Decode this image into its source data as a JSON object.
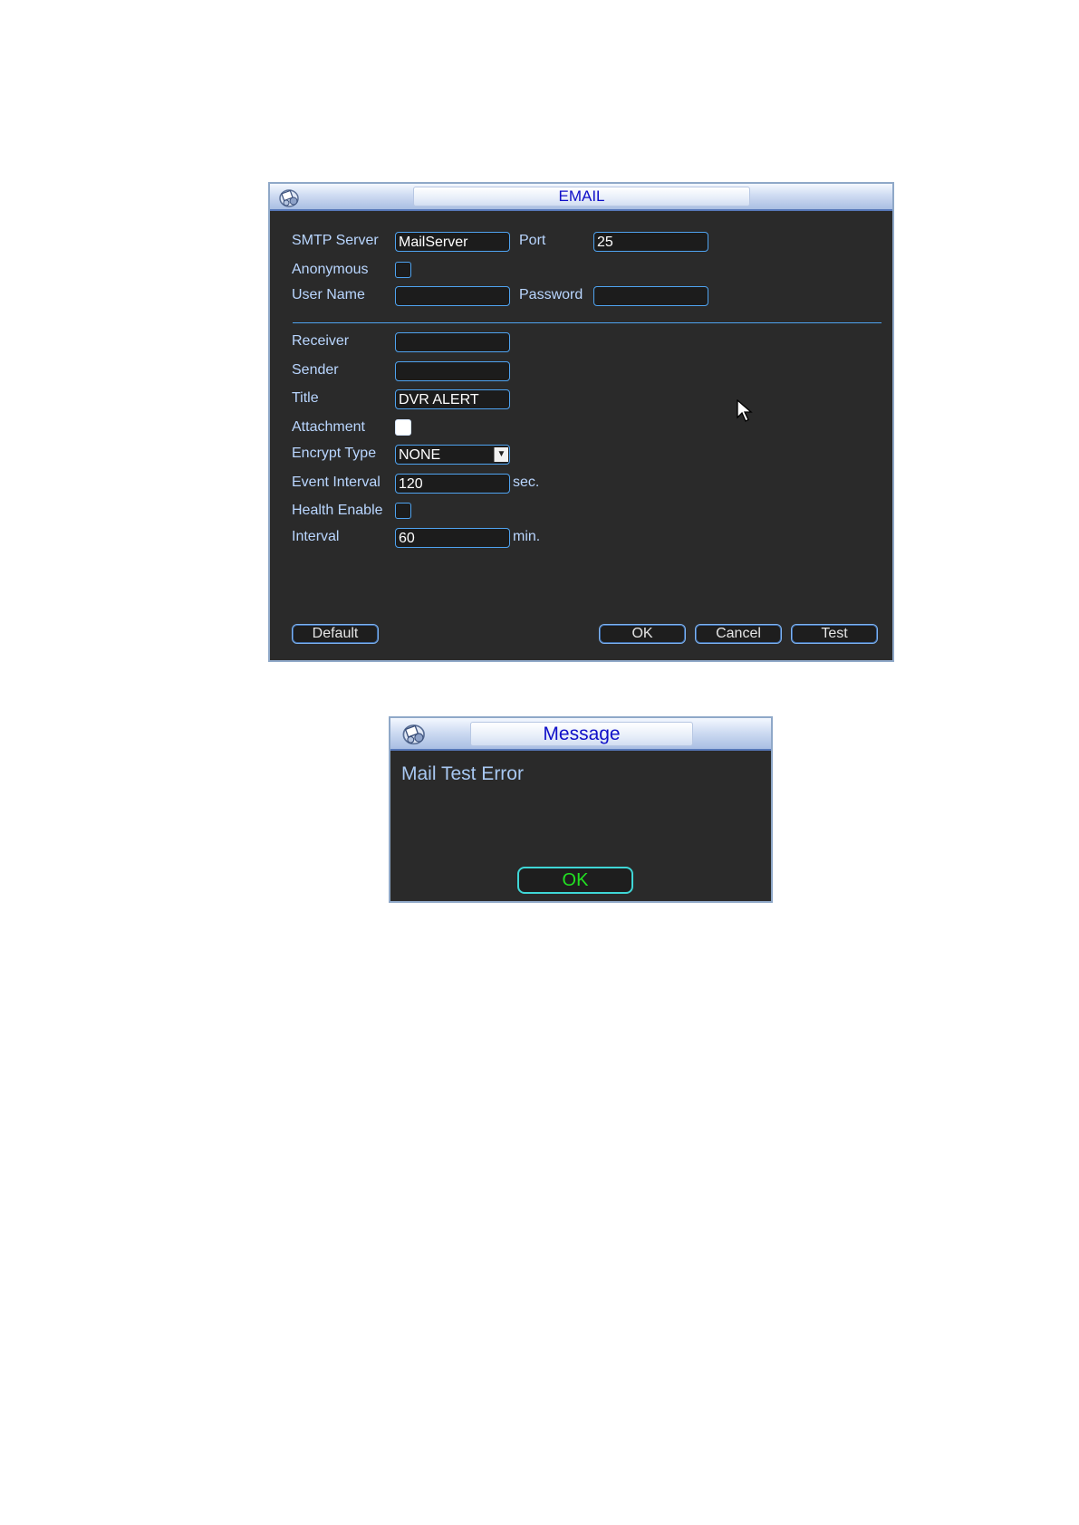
{
  "email_dialog": {
    "title": "EMAIL",
    "smtp_server_label": "SMTP Server",
    "smtp_server_value": "MailServer",
    "port_label": "Port",
    "port_value": "25",
    "anonymous_label": "Anonymous",
    "anonymous_checked": false,
    "user_name_label": "User Name",
    "user_name_value": "",
    "password_label": "Password",
    "password_value": "",
    "receiver_label": "Receiver",
    "receiver_value": "",
    "sender_label": "Sender",
    "sender_value": "",
    "title_label": "Title",
    "title_value": "DVR ALERT",
    "attachment_label": "Attachment",
    "attachment_checked": true,
    "encrypt_type_label": "Encrypt Type",
    "encrypt_type_value": "NONE",
    "event_interval_label": "Event Interval",
    "event_interval_value": "120",
    "event_interval_unit": "sec.",
    "health_enable_label": "Health Enable",
    "health_enable_checked": false,
    "interval_label": "Interval",
    "interval_value": "60",
    "interval_unit": "min.",
    "buttons": {
      "default": "Default",
      "ok": "OK",
      "cancel": "Cancel",
      "test": "Test"
    }
  },
  "message_dialog": {
    "title": "Message",
    "text": "Mail Test Error",
    "ok_label": "OK"
  },
  "icons": {
    "dialog_logo": "dvr-logo-icon",
    "cursor": "mouse-pointer-icon"
  },
  "colors": {
    "title_text": "#1010c8",
    "label_text": "#b9d6ff",
    "field_border": "#4fa3f0",
    "dialog_bg": "#2a2a2a",
    "message_ok_text": "#22e022"
  }
}
